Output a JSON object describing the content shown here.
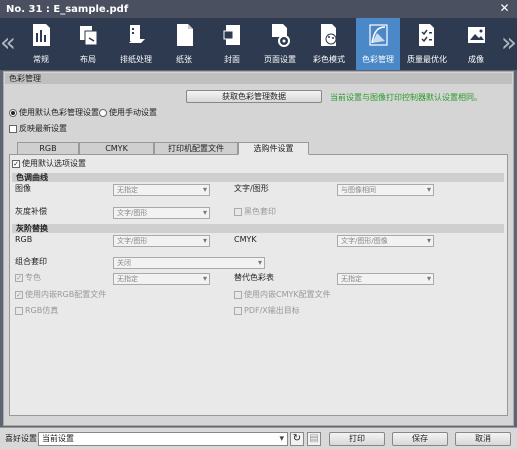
{
  "window": {
    "title": "No. 31 : E_sample.pdf",
    "close_glyph": "✕"
  },
  "toolbar": {
    "left_arrow": "«",
    "right_arrow": "»",
    "items": [
      {
        "label": "常规",
        "icon": "general-icon"
      },
      {
        "label": "布局",
        "icon": "layout-icon"
      },
      {
        "label": "排纸处理",
        "icon": "output-icon"
      },
      {
        "label": "纸张",
        "icon": "paper-icon"
      },
      {
        "label": "封面",
        "icon": "cover-icon"
      },
      {
        "label": "页面设置",
        "icon": "page-settings-icon"
      },
      {
        "label": "彩色模式",
        "icon": "color-mode-icon"
      },
      {
        "label": "色彩管理",
        "icon": "color-management-icon",
        "active": true
      },
      {
        "label": "质量最优化",
        "icon": "quality-icon"
      },
      {
        "label": "成像",
        "icon": "imaging-icon"
      }
    ]
  },
  "section": {
    "title": "色彩管理",
    "get_button": "获取色彩管理数据",
    "notice": "当前设置与图像打印控制器默认设置相同。",
    "radio_default": "使用默认色彩管理设置",
    "radio_manual": "使用手动设置",
    "reflect_latest": "反映最新设置"
  },
  "tabs": [
    "RGB",
    "CMYK",
    "打印机配置文件",
    "选购件设置"
  ],
  "options": {
    "use_default": "使用默认选项设置",
    "tone_curve": {
      "heading": "色调曲线",
      "image_label": "图像",
      "image_value": "无指定",
      "text_label": "文字/图形",
      "text_value": "与图像相同"
    },
    "gray_comp": {
      "label": "灰度补偿",
      "value": "文字/图形",
      "black_overprint": "黑色套印"
    },
    "gray_replace": {
      "heading": "灰阶替换",
      "rgb_label": "RGB",
      "rgb_value": "文字/图形",
      "cmyk_label": "CMYK",
      "cmyk_value": "文字/图形/图像"
    },
    "combo_overprint": {
      "label": "组合套印",
      "value": "关闭"
    },
    "spot": {
      "label": "专色",
      "value": "无指定",
      "alt_label": "替代色彩表",
      "alt_value": "无指定"
    },
    "embedded_rgb": "使用内嵌RGB配置文件",
    "embedded_cmyk": "使用内嵌CMYK配置文件",
    "rgb_sim": "RGB仿真",
    "pdfx": "PDF/X输出目标"
  },
  "bottom": {
    "favorite_label": "喜好设置",
    "favorite_value": "当前设置",
    "refresh_glyph": "↻",
    "save_icon_glyph": "▤",
    "print": "打印",
    "save": "保存",
    "cancel": "取消"
  }
}
